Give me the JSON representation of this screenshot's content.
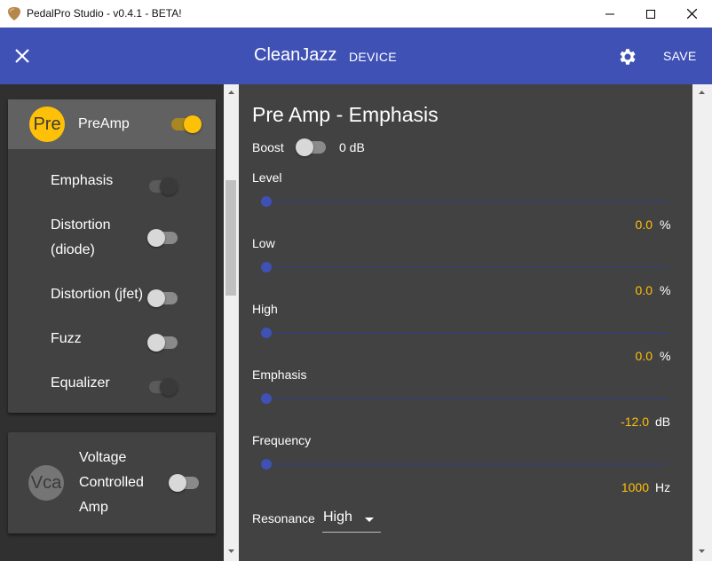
{
  "window": {
    "title": "PedalPro Studio - v0.4.1 - BETA!",
    "icon": "guitar-pick-icon"
  },
  "appbar": {
    "preset_name": "CleanJazz",
    "device_label": "DEVICE",
    "save_label": "SAVE",
    "accent_color": "#3f51b5"
  },
  "sidebar": {
    "preamp": {
      "avatar": "Pre",
      "label": "PreAmp",
      "enabled": true,
      "items": [
        {
          "label": "Emphasis",
          "enabled": false,
          "disabled": true
        },
        {
          "label": "Distortion",
          "label2": "(diode)",
          "enabled": false,
          "disabled": false
        },
        {
          "label": "Distortion (jfet)",
          "enabled": false,
          "disabled": false
        },
        {
          "label": "Fuzz",
          "enabled": false,
          "disabled": false
        },
        {
          "label": "Equalizer",
          "enabled": false,
          "disabled": true
        }
      ]
    },
    "vca": {
      "avatar": "Vca",
      "label_line1": "Voltage",
      "label_line2": "Controlled",
      "label_line3": "Amp",
      "enabled": false
    }
  },
  "panel": {
    "title": "Pre Amp - Emphasis",
    "boost": {
      "label": "Boost",
      "value": "0 dB",
      "enabled": false
    },
    "sliders": [
      {
        "label": "Level",
        "value": "0.0",
        "unit": "%",
        "fraction": 0.0
      },
      {
        "label": "Low",
        "value": "0.0",
        "unit": "%",
        "fraction": 0.0
      },
      {
        "label": "High",
        "value": "0.0",
        "unit": "%",
        "fraction": 0.0
      },
      {
        "label": "Emphasis",
        "value": "-12.0",
        "unit": "dB",
        "fraction": 0.0
      },
      {
        "label": "Frequency",
        "value": "1000",
        "unit": "Hz",
        "fraction": 0.0
      }
    ],
    "resonance": {
      "label": "Resonance",
      "value": "High"
    }
  }
}
